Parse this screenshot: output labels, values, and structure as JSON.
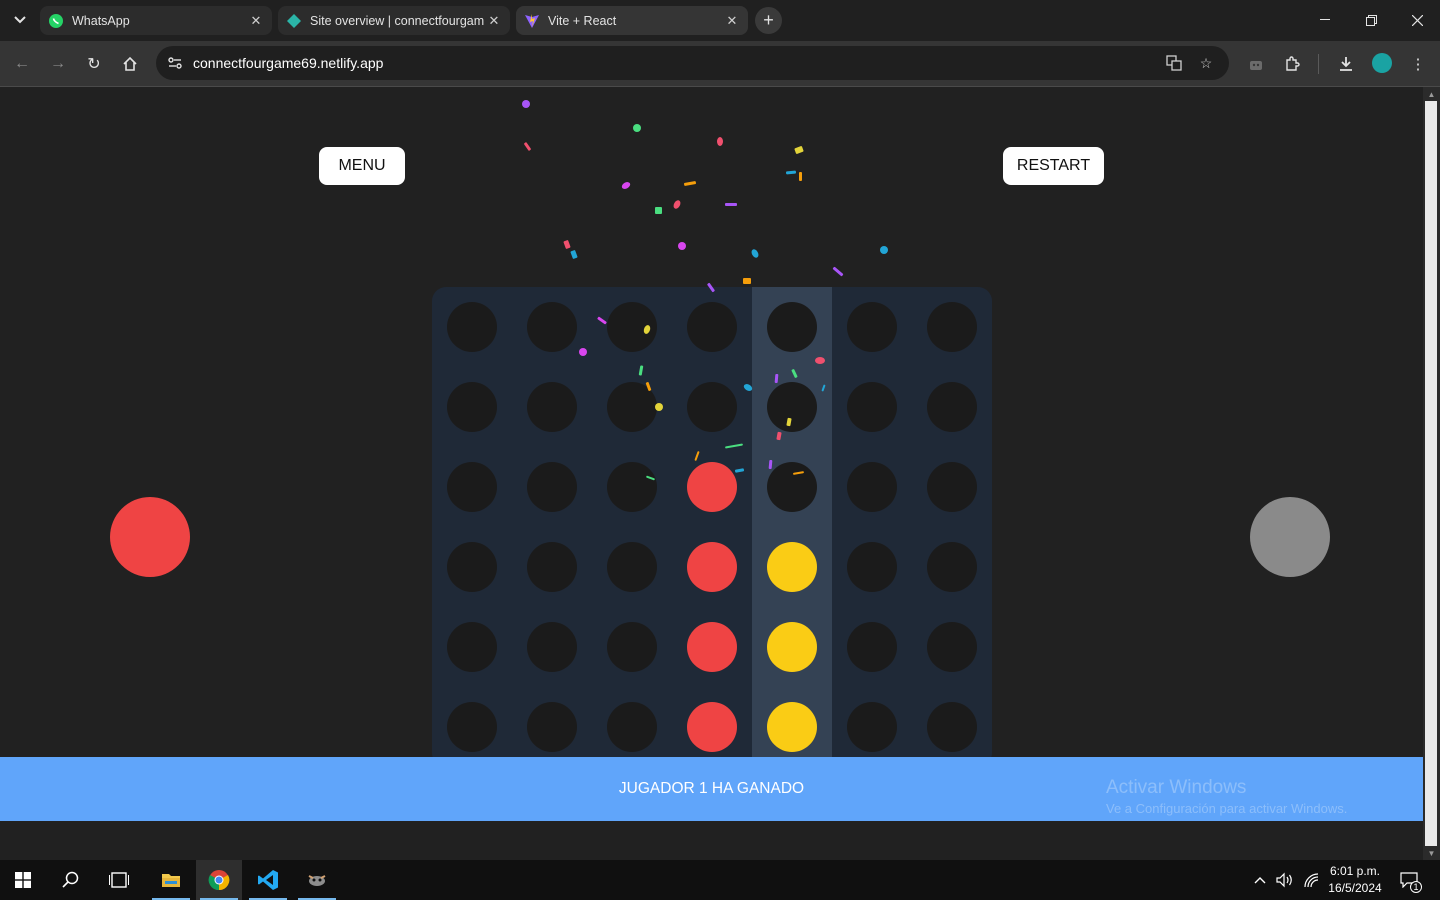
{
  "browser": {
    "tabs": [
      {
        "title": "WhatsApp",
        "icon": "whatsapp-icon"
      },
      {
        "title": "Site overview | connectfourgam",
        "icon": "netlify-icon"
      },
      {
        "title": "Vite + React",
        "icon": "vite-icon"
      }
    ],
    "url": "connectfourgame69.netlify.app"
  },
  "game": {
    "menu_label": "MENU",
    "restart_label": "RESTART",
    "status_message": "JUGADOR 1 HA GANADO",
    "columns": 7,
    "rows": 6,
    "highlighted_column": 4,
    "board": [
      [
        "empty",
        "empty",
        "empty",
        "empty",
        "empty",
        "empty",
        "empty"
      ],
      [
        "empty",
        "empty",
        "empty",
        "empty",
        "empty",
        "empty",
        "empty"
      ],
      [
        "empty",
        "empty",
        "empty",
        "red",
        "empty",
        "empty",
        "empty"
      ],
      [
        "empty",
        "empty",
        "empty",
        "red",
        "yellow",
        "empty",
        "empty"
      ],
      [
        "empty",
        "empty",
        "empty",
        "red",
        "yellow",
        "empty",
        "empty"
      ],
      [
        "empty",
        "empty",
        "empty",
        "red",
        "yellow",
        "empty",
        "empty"
      ]
    ],
    "player1_color": "#ef4444",
    "player2_color": "#9ca3af",
    "yellow_color": "#facc15",
    "board_color": "#1f2937",
    "banner_color": "#60a5fa"
  },
  "watermark": {
    "line1": "Activar Windows",
    "line2": "Ve a Configuración para activar Windows."
  },
  "taskbar": {
    "time": "6:01 p.m.",
    "date": "16/5/2024",
    "notification_count": "1"
  }
}
